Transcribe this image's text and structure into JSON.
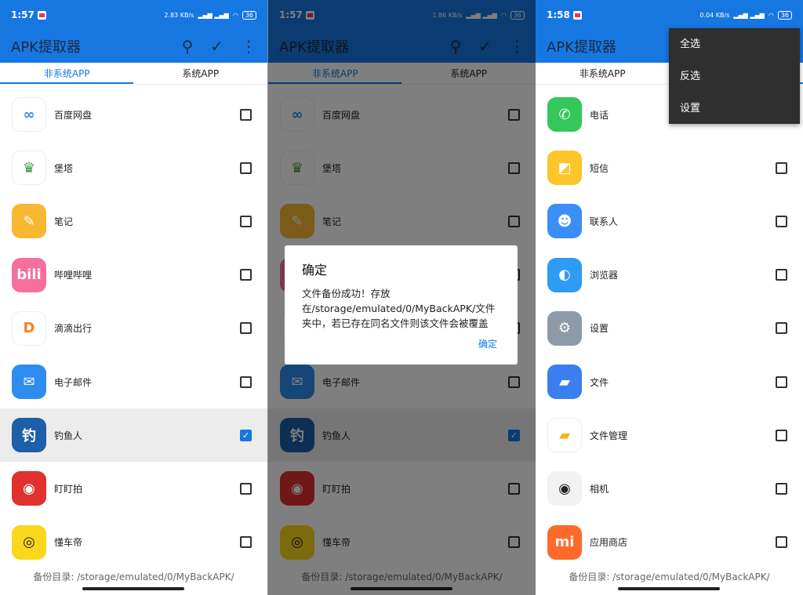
{
  "app_title": "APK提取器",
  "tabs": [
    "非系统APP",
    "系统APP"
  ],
  "footer": "备份目录: /storage/emulated/0/MyBackAPK/",
  "screens": [
    {
      "time": "1:57",
      "speed": "2.83 KB/s",
      "battery": "36",
      "selected_tab": 0,
      "apps": [
        {
          "name": "百度网盘",
          "color": "#ffffff",
          "glyph": "∞",
          "fg": "#2f8cf0",
          "checked": false
        },
        {
          "name": "堡塔",
          "color": "#ffffff",
          "glyph": "♛",
          "fg": "#3a9a3a",
          "checked": false
        },
        {
          "name": "笔记",
          "color": "#f7b731",
          "glyph": "✎",
          "fg": "#fff",
          "checked": false
        },
        {
          "name": "哔哩哔哩",
          "color": "#f76f9c",
          "glyph": "bili",
          "fg": "#fff",
          "checked": false
        },
        {
          "name": "滴滴出行",
          "color": "#ffffff",
          "glyph": "D",
          "fg": "#f58220",
          "checked": false
        },
        {
          "name": "电子邮件",
          "color": "#2d8cf0",
          "glyph": "✉",
          "fg": "#fff",
          "checked": false
        },
        {
          "name": "钓鱼人",
          "color": "#1d5fa8",
          "glyph": "钓",
          "fg": "#fff",
          "checked": true
        },
        {
          "name": "盯盯拍",
          "color": "#e0312f",
          "glyph": "◉",
          "fg": "#fff",
          "checked": false
        },
        {
          "name": "懂车帝",
          "color": "#f9d71c",
          "glyph": "◎",
          "fg": "#222",
          "checked": false
        }
      ]
    },
    {
      "time": "1:57",
      "speed": "1.86 KB/s",
      "battery": "36",
      "selected_tab": 0,
      "same_list": true,
      "dialog": {
        "title": "确定",
        "message": "文件备份成功！存放在/storage/emulated/0/MyBackAPK/文件夹中，若已存在同名文件则该文件会被覆盖",
        "ok": "确定"
      }
    },
    {
      "time": "1:58",
      "speed": "0.04 KB/s",
      "battery": "36",
      "selected_tab": 1,
      "apps": [
        {
          "name": "电话",
          "color": "#34c759",
          "glyph": "✆",
          "fg": "#fff",
          "checked": false
        },
        {
          "name": "短信",
          "color": "#ffc629",
          "glyph": "◩",
          "fg": "#fff",
          "checked": false
        },
        {
          "name": "联系人",
          "color": "#3a8ef6",
          "glyph": "☻",
          "fg": "#fff",
          "checked": false
        },
        {
          "name": "浏览器",
          "color": "#2e9bf5",
          "glyph": "◐",
          "fg": "#fff",
          "checked": false
        },
        {
          "name": "设置",
          "color": "#8e9aa8",
          "glyph": "⚙",
          "fg": "#fff",
          "checked": false
        },
        {
          "name": "文件",
          "color": "#3a7ef0",
          "glyph": "▰",
          "fg": "#fff",
          "checked": false
        },
        {
          "name": "文件管理",
          "color": "#ffffff",
          "glyph": "▰",
          "fg": "#f8b417",
          "checked": false
        },
        {
          "name": "相机",
          "color": "#f2f2f2",
          "glyph": "◉",
          "fg": "#222",
          "checked": false
        },
        {
          "name": "应用商店",
          "color": "#ff6a2b",
          "glyph": "mi",
          "fg": "#fff",
          "checked": false
        }
      ],
      "menu": [
        "全选",
        "反选",
        "设置"
      ]
    }
  ]
}
